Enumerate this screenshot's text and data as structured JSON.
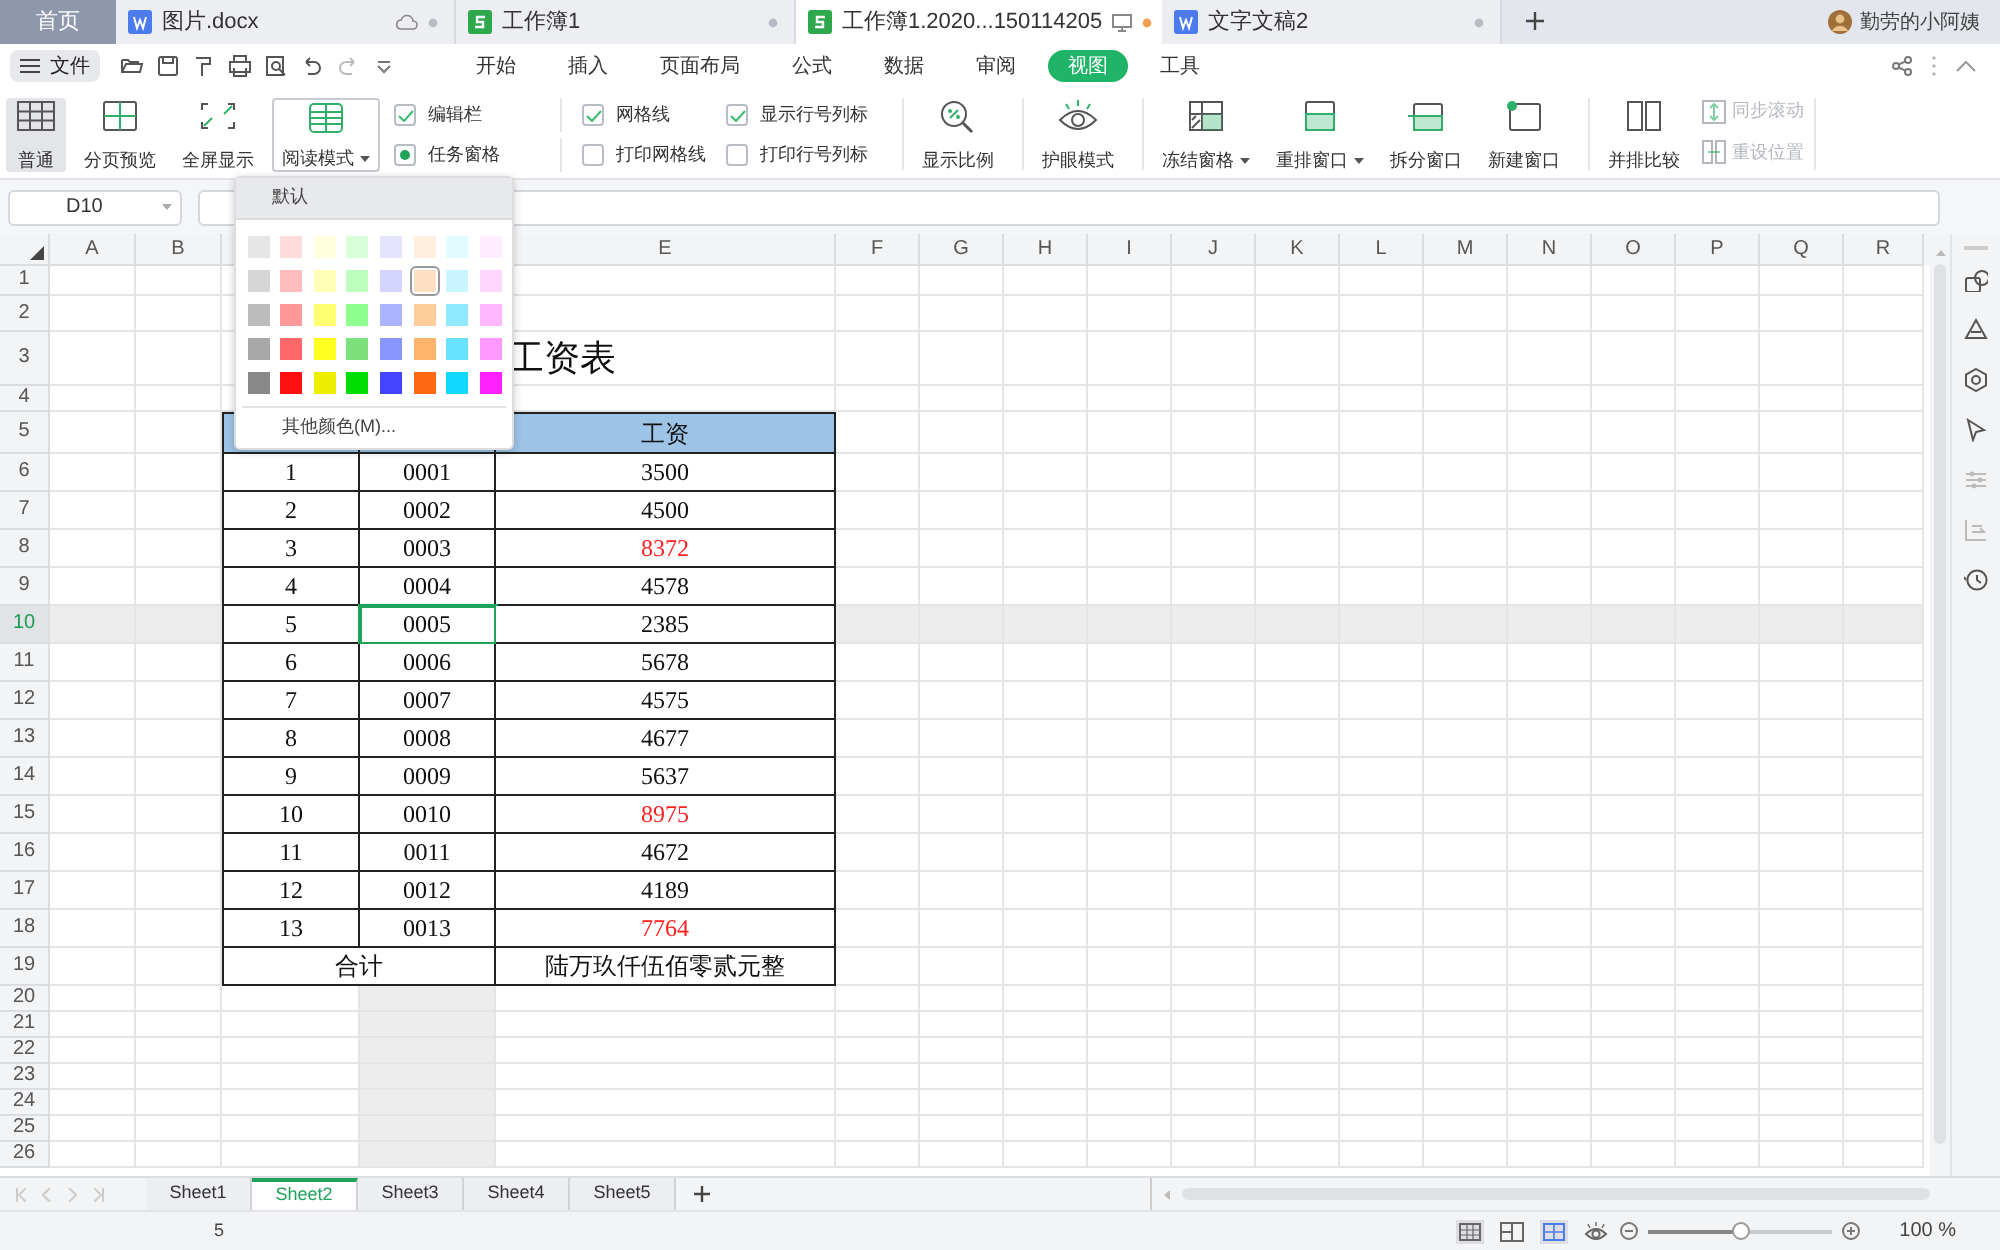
{
  "doc_tabs": [
    {
      "label": "首页",
      "kind": "home",
      "selected": false
    },
    {
      "label": "图片.docx",
      "kind": "writer",
      "selected": false,
      "modified": false,
      "cloud": true
    },
    {
      "label": "工作簿1",
      "kind": "sheet",
      "selected": false,
      "modified": false
    },
    {
      "label": "工作簿1.2020...150114205",
      "kind": "sheet",
      "selected": true,
      "modified": true
    },
    {
      "label": "文字文稿2",
      "kind": "writer",
      "selected": false,
      "modified": false
    }
  ],
  "user": {
    "name": "勤劳的小阿姨"
  },
  "menu": {
    "file": "文件",
    "tabs": [
      {
        "label": "开始",
        "selected": false
      },
      {
        "label": "插入",
        "selected": false
      },
      {
        "label": "页面布局",
        "selected": false
      },
      {
        "label": "公式",
        "selected": false
      },
      {
        "label": "数据",
        "selected": false
      },
      {
        "label": "审阅",
        "selected": false
      },
      {
        "label": "视图",
        "selected": true
      },
      {
        "label": "工具",
        "selected": false
      }
    ]
  },
  "view_buttons": [
    {
      "label": "普通",
      "selected": true,
      "expanded": false
    },
    {
      "label": "分页预览",
      "selected": false,
      "expanded": false
    },
    {
      "label": "全屏显示",
      "selected": false,
      "expanded": false
    },
    {
      "label": "阅读模式",
      "selected": false,
      "expanded": true,
      "dropdown": true
    }
  ],
  "options": [
    {
      "label": "编辑栏",
      "kind": "checkbox",
      "checked": true
    },
    {
      "label": "网格线",
      "kind": "checkbox",
      "checked": true
    },
    {
      "label": "显示行号列标",
      "kind": "checkbox",
      "checked": true
    },
    {
      "label": "任务窗格",
      "kind": "radio",
      "checked": true
    },
    {
      "label": "打印网格线",
      "kind": "checkbox",
      "checked": false
    },
    {
      "label": "打印行号列标",
      "kind": "checkbox",
      "checked": false
    }
  ],
  "tools": [
    {
      "label": "显示比例"
    },
    {
      "label": "护眼模式"
    },
    {
      "label": "冻结窗格",
      "dropdown": true
    },
    {
      "label": "重排窗口",
      "dropdown": true
    },
    {
      "label": "拆分窗口"
    },
    {
      "label": "新建窗口"
    },
    {
      "label": "并排比较"
    }
  ],
  "sync": [
    {
      "label": "同步滚动",
      "disabled": true
    },
    {
      "label": "重设位置",
      "disabled": true
    }
  ],
  "name_box": "D10",
  "column_headers": [
    "A",
    "B",
    "E",
    "F",
    "G",
    "H",
    "I",
    "J",
    "K",
    "L",
    "M",
    "N",
    "O",
    "P",
    "Q",
    "R"
  ],
  "row_headers": [
    "1",
    "2",
    "3",
    "4",
    "5",
    "6",
    "7",
    "8",
    "9",
    "10",
    "11",
    "12",
    "13",
    "14",
    "15",
    "16",
    "17",
    "18",
    "19",
    "20",
    "21",
    "22",
    "23",
    "24",
    "25",
    "26"
  ],
  "table": {
    "title": "工资表",
    "header": "工资",
    "rows": [
      {
        "no": "1",
        "id": "0001",
        "salary": "3500",
        "flagged": false,
        "selected": false
      },
      {
        "no": "2",
        "id": "0002",
        "salary": "4500",
        "flagged": false,
        "selected": false
      },
      {
        "no": "3",
        "id": "0003",
        "salary": "8372",
        "flagged": true,
        "selected": false
      },
      {
        "no": "4",
        "id": "0004",
        "salary": "4578",
        "flagged": false,
        "selected": false
      },
      {
        "no": "5",
        "id": "0005",
        "salary": "2385",
        "flagged": false,
        "selected": true
      },
      {
        "no": "6",
        "id": "0006",
        "salary": "5678",
        "flagged": false,
        "selected": false
      },
      {
        "no": "7",
        "id": "0007",
        "salary": "4575",
        "flagged": false,
        "selected": false
      },
      {
        "no": "8",
        "id": "0008",
        "salary": "4677",
        "flagged": false,
        "selected": false
      },
      {
        "no": "9",
        "id": "0009",
        "salary": "5637",
        "flagged": false,
        "selected": false
      },
      {
        "no": "10",
        "id": "0010",
        "salary": "8975",
        "flagged": true,
        "selected": false
      },
      {
        "no": "11",
        "id": "0011",
        "salary": "4672",
        "flagged": false,
        "selected": false
      },
      {
        "no": "12",
        "id": "0012",
        "salary": "4189",
        "flagged": false,
        "selected": false
      },
      {
        "no": "13",
        "id": "0013",
        "salary": "7764",
        "flagged": true,
        "selected": false
      }
    ],
    "total": {
      "label": "合计",
      "amount": "陆万玖仟伍佰零贰元整"
    }
  },
  "color_menu": {
    "default_label": "默认",
    "more_label": "其他颜色(M)...",
    "swatches": [
      {
        "color": "#e6e6e6",
        "selected": false
      },
      {
        "color": "#ffdcdc",
        "selected": false
      },
      {
        "color": "#ffffe0",
        "selected": false
      },
      {
        "color": "#d9ffd9",
        "selected": false
      },
      {
        "color": "#e4e4ff",
        "selected": false
      },
      {
        "color": "#ffeedd",
        "selected": false
      },
      {
        "color": "#e0fbff",
        "selected": false
      },
      {
        "color": "#ffeeff",
        "selected": false
      },
      {
        "color": "#d6d6d6",
        "selected": false
      },
      {
        "color": "#ffbcbc",
        "selected": false
      },
      {
        "color": "#ffffb8",
        "selected": false
      },
      {
        "color": "#bcffbc",
        "selected": false
      },
      {
        "color": "#d4d4ff",
        "selected": false
      },
      {
        "color": "#ffdfc4",
        "selected": true
      },
      {
        "color": "#c8f5ff",
        "selected": false
      },
      {
        "color": "#ffd6ff",
        "selected": false
      },
      {
        "color": "#bcbcbc",
        "selected": false
      },
      {
        "color": "#ff9898",
        "selected": false
      },
      {
        "color": "#ffff70",
        "selected": false
      },
      {
        "color": "#8cff8c",
        "selected": false
      },
      {
        "color": "#aab4ff",
        "selected": false
      },
      {
        "color": "#ffcc9c",
        "selected": false
      },
      {
        "color": "#90e8ff",
        "selected": false
      },
      {
        "color": "#ffb8ff",
        "selected": false
      },
      {
        "color": "#a8a8a8",
        "selected": false
      },
      {
        "color": "#ff6868",
        "selected": false
      },
      {
        "color": "#ffff20",
        "selected": false
      },
      {
        "color": "#7ce07c",
        "selected": false
      },
      {
        "color": "#8a96ff",
        "selected": false
      },
      {
        "color": "#ffb46c",
        "selected": false
      },
      {
        "color": "#68e0ff",
        "selected": false
      },
      {
        "color": "#ff98ff",
        "selected": false
      },
      {
        "color": "#888888",
        "selected": false
      },
      {
        "color": "#ff1010",
        "selected": false
      },
      {
        "color": "#eeee00",
        "selected": false
      },
      {
        "color": "#00dd00",
        "selected": false
      },
      {
        "color": "#4444ff",
        "selected": false
      },
      {
        "color": "#ff6a10",
        "selected": false
      },
      {
        "color": "#10d8ff",
        "selected": false
      },
      {
        "color": "#ff20ff",
        "selected": false
      }
    ]
  },
  "sheet_tabs": [
    {
      "label": "Sheet1",
      "selected": false
    },
    {
      "label": "Sheet2",
      "selected": true
    },
    {
      "label": "Sheet3",
      "selected": false
    },
    {
      "label": "Sheet4",
      "selected": false
    },
    {
      "label": "Sheet5",
      "selected": false
    }
  ],
  "status_bar": {
    "value": "5",
    "zoom": {
      "level": 0.5,
      "reading": "100 %"
    }
  }
}
